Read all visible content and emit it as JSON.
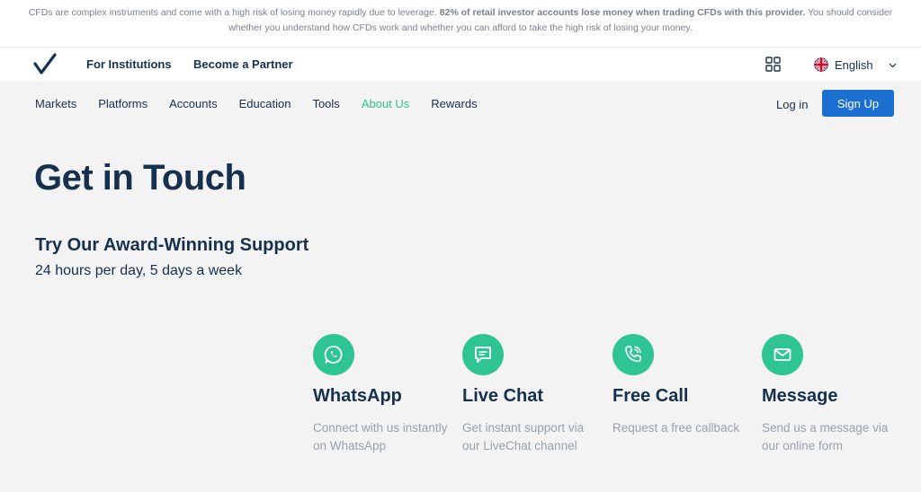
{
  "risk_banner": {
    "pre": "CFDs are complex instruments and come with a high risk of losing money rapidly due to leverage. ",
    "bold": "82% of retail investor accounts lose money when trading CFDs with this provider.",
    "post": " You should consider whether you understand how CFDs work and whether you can afford to take the high risk of losing your money."
  },
  "topbar": {
    "links": [
      "For Institutions",
      "Become a Partner"
    ],
    "language": "English",
    "icons": {
      "logo": "checkmark-logo",
      "apps": "apps-grid-icon",
      "flag": "uk-flag-icon",
      "chevron": "chevron-down-icon"
    }
  },
  "nav": {
    "items": [
      "Markets",
      "Platforms",
      "Accounts",
      "Education",
      "Tools",
      "About Us",
      "Rewards"
    ],
    "active": "About Us",
    "login": "Log in",
    "signup": "Sign Up"
  },
  "hero": {
    "title": "Get in Touch",
    "subtitle": "Try Our Award-Winning Support",
    "hours": "24 hours per day, 5 days a week"
  },
  "channels": [
    {
      "icon": "whatsapp-icon",
      "title": "WhatsApp",
      "desc": "Connect with us instantly on WhatsApp"
    },
    {
      "icon": "chat-icon",
      "title": "Live Chat",
      "desc": "Get instant support via our LiveChat channel"
    },
    {
      "icon": "phone-icon",
      "title": "Free Call",
      "desc": "Request a free callback"
    },
    {
      "icon": "envelope-icon",
      "title": "Message",
      "desc": "Send us a message via our online form"
    }
  ],
  "colors": {
    "brand_navy": "#16304f",
    "accent_green": "#2ec494",
    "button_blue": "#1b6fd1",
    "muted_text": "#9aa1a9",
    "background": "#f3f3f3"
  }
}
